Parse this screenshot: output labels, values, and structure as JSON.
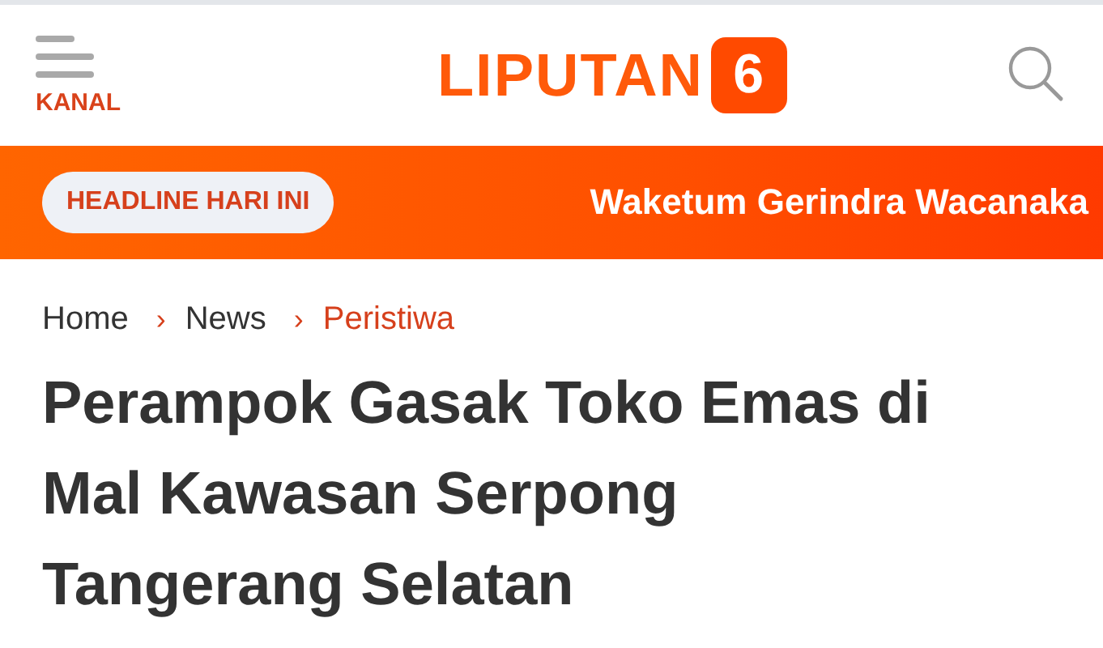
{
  "header": {
    "menu_label": "KANAL",
    "logo_text": "LIPUTAN",
    "logo_number": "6"
  },
  "headline_bar": {
    "badge": "HEADLINE HARI INI",
    "ticker": "Waketum Gerindra Wacanaka"
  },
  "breadcrumb": [
    {
      "label": "Home",
      "current": false
    },
    {
      "label": "News",
      "current": false
    },
    {
      "label": "Peristiwa",
      "current": true
    }
  ],
  "separator": "›",
  "article": {
    "title": "Perampok Gasak Toko Emas di Mal Kawasan Serpong Tangerang Selatan"
  }
}
